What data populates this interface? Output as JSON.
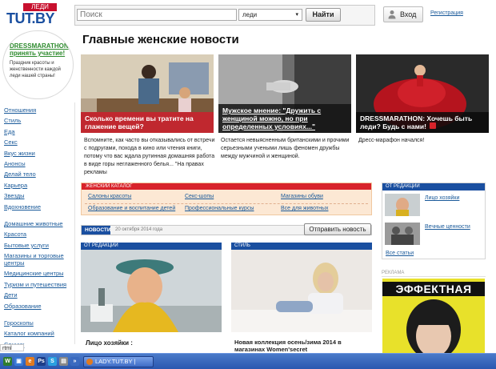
{
  "header": {
    "logo_small": "ЛЕДИ",
    "logo_main": "TUT.BY",
    "search": {
      "placeholder": "Поиск",
      "scope": "леди",
      "button": "Найти"
    },
    "login": "Вход",
    "register": "Регистрация"
  },
  "promo": {
    "title": "DRESSMARATHON принять участие!",
    "text": "Праздник красоты и женственности каждой леди нашей страны!"
  },
  "sidebar": {
    "group1": [
      "Отношения",
      "Стиль",
      "Еда",
      "Секс",
      "Вкус жизни",
      "Анонсы",
      "Делай тело",
      "Карьера",
      "Звезды",
      "Вдохновение"
    ],
    "group2": [
      "Домашние животные",
      "Красота",
      "Бытовые услуги",
      "Магазины и торговые центры",
      "Медицинские центры",
      "Туризм и путешествия",
      "Дети",
      "Образование"
    ],
    "group3": [
      "Гороскопы",
      "Каталог компаний",
      "Сонник"
    ]
  },
  "main": {
    "title": "Главные женские новости",
    "heroes": [
      {
        "caption": "Сколько времени вы тратите на глажение вещей?",
        "text": "Вспомните, как часто вы отказывались от встречи с подругами, похода в кино или чтения книги, потому что вас ждала рутинная домашняя работа в виде горы неглаженного белья... \"На правах рекламы"
      },
      {
        "caption": "Мужское мнение: \"Дружить с женщиной можно, но при определенных условиях...\"",
        "text": "Остается невыясненным британскими и прочими серьезными учеными лишь феномен дружбы между мужчиной и женщиной."
      },
      {
        "caption": "DRESSMARATHON: Хочешь быть леди? Будь с нами!",
        "text": "Дресс-марафон начался!"
      }
    ],
    "catalog": {
      "header": "ЖЕНСКИЙ КАТАЛОГ",
      "row1": [
        "Салоны красоты",
        "Секс-шопы",
        "Магазины обуви"
      ],
      "row2": [
        "Образование и воспитание детей",
        "Профессиональные курсы",
        "Все для животных"
      ]
    },
    "news": {
      "tab": "НОВОСТИ",
      "date": "20 октября 2014 года",
      "button": "Отправить новость"
    },
    "cards": [
      {
        "tag": "ОТ РЕДАКЦИИ",
        "title": "Лицо хозяйки :"
      },
      {
        "tag": "СТИЛЬ",
        "title": "Новая коллекция осень/зима 2014 в магазинах Women'secret"
      }
    ]
  },
  "editorial": {
    "header": "ОТ РЕДАКЦИИ",
    "items": [
      "Лицо хозяйки",
      "Вечные ценности"
    ],
    "all": "Все статьи"
  },
  "ads": {
    "label": "РЕКЛАМА",
    "headline": "ЭФФЕКТНАЯ"
  },
  "statusbar": {
    "tip": "rtml"
  },
  "taskbar": {
    "window": "LADY.TUT.BY |"
  },
  "colors": {
    "brand_blue": "#1a4fa0",
    "accent_red": "#d8232a",
    "catalog_bg": "#fce8d4",
    "ad_yellow": "#e8e12a"
  }
}
